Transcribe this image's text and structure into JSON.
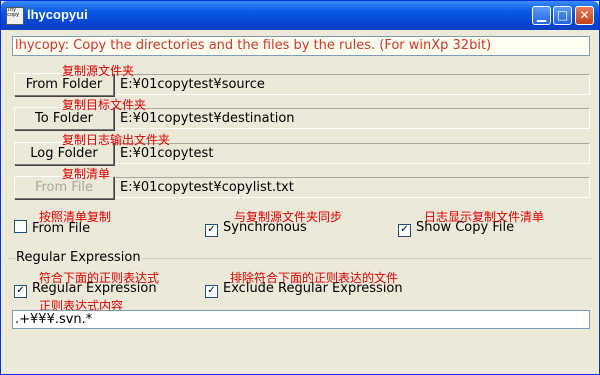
{
  "window": {
    "title": "lhycopyui",
    "icon_text": "lhy copy"
  },
  "headline": "lhycopy: Copy the directories and the files by the rules.  (For winXp 32bit)",
  "rows": [
    {
      "button": "From Folder",
      "path": "E:¥01copytest¥source",
      "note": "复制源文件夹",
      "enabled": true
    },
    {
      "button": "To Folder",
      "path": "E:¥01copytest¥destination",
      "note": "复制目标文件夹",
      "enabled": true
    },
    {
      "button": "Log Folder",
      "path": "E:¥01copytest",
      "note": "复制日志输出文件夹",
      "enabled": true
    },
    {
      "button": "From File",
      "path": "E:¥01copytest¥copylist.txt",
      "note": "复制清单",
      "enabled": false
    }
  ],
  "options": [
    {
      "label": "From File",
      "checked": false,
      "note": "按照清单复制"
    },
    {
      "label": "Synchronous",
      "checked": true,
      "note": "与复制源文件夹同步"
    },
    {
      "label": "Show Copy File",
      "checked": true,
      "note": "日志显示复制文件清单"
    }
  ],
  "regex_group": {
    "label": "Regular Expression",
    "options": [
      {
        "label": "Regular Expression",
        "checked": true,
        "note": "符合下面的正则表达式"
      },
      {
        "label": "Exclude Regular Expression",
        "checked": true,
        "note": "排除符合下面的正则表达的文件"
      }
    ],
    "field_note": "正则表达式内容",
    "field_value": ".+¥¥¥.svn.*"
  },
  "colors": {
    "annotation": "#e00000",
    "headline_text": "#d2342a",
    "titlebar": "#0a5ae8"
  }
}
